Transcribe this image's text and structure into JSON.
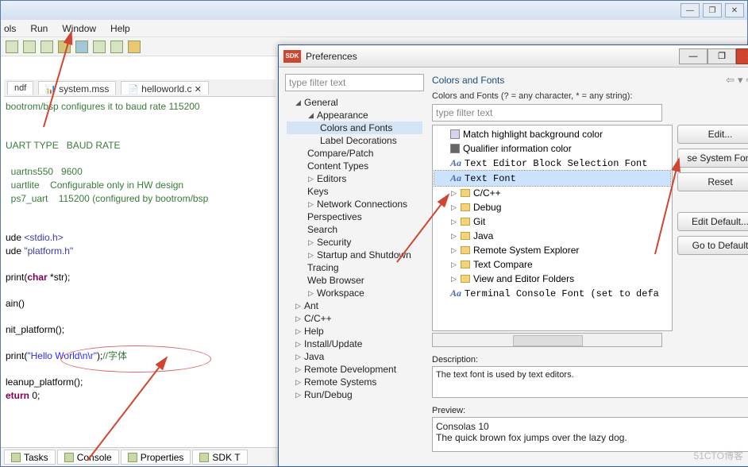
{
  "main": {
    "menu": [
      "ols",
      "Run",
      "Window",
      "Help"
    ],
    "tabs": {
      "mdf": "ndf",
      "mss": "system.mss",
      "hw": "helloworld.c"
    },
    "code": {
      "l1": "bootrom/bsp configures it to baud rate 115200",
      "hdr1": "UART TYPE   BAUD RATE",
      "u1": "  uartns550   9600",
      "u2": "  uartlite    Configurable only in HW design",
      "u3": "  ps7_uart    115200 (configured by bootrom/bsp",
      "inc1": "ude ",
      "inc1b": "<stdio.h>",
      "inc2": "ude ",
      "inc2b": "\"platform.h\"",
      "fn1": "print(",
      "fn1t": "char",
      " fn1r": " *str);",
      "fn2": "ain()",
      "ip": "nit_platform();",
      "pr": "print(",
      "prs": "\"Hello World\\n\\r\"",
      "prr": ");",
      "prc": "//字体",
      "cl": "leanup_platform();",
      "ret": "eturn",
      " retv": " 0;"
    },
    "btabs": [
      "Tasks",
      "Console",
      "Properties",
      "SDK T"
    ]
  },
  "pref": {
    "title": "Preferences",
    "logo": "SDK",
    "filter_ph": "type filter text",
    "tree": {
      "general": "General",
      "appearance": "Appearance",
      "colors_fonts": "Colors and Fonts",
      "label_dec": "Label Decorations",
      "compare": "Compare/Patch",
      "content": "Content Types",
      "editors": "Editors",
      "keys": "Keys",
      "network": "Network Connections",
      "persp": "Perspectives",
      "search": "Search",
      "security": "Security",
      "startup": "Startup and Shutdown",
      "tracing": "Tracing",
      "web": "Web Browser",
      "workspace": "Workspace",
      "ant": "Ant",
      "cpp": "C/C++",
      "help": "Help",
      "install": "Install/Update",
      "java": "Java",
      "remote": "Remote Development",
      "remotes": "Remote Systems",
      "rundebug": "Run/Debug"
    },
    "right": {
      "heading": "Colors and Fonts",
      "desc": "Colors and Fonts (? = any character, * = any string):",
      "filter_ph": "type filter text",
      "items": {
        "match": "Match highlight background color",
        "qual": "Qualifier information color",
        "block": "Text Editor Block Selection Font",
        "text": "Text Font",
        "cpp": "C/C++",
        "debug": "Debug",
        "git": "Git",
        "java": "Java",
        "rse": "Remote System Explorer",
        "tcmp": "Text Compare",
        "view": "View and Editor Folders",
        "term": "Terminal Console Font (set to defa"
      },
      "btns": {
        "edit": "Edit...",
        "sys": "se System Font",
        "reset": "Reset",
        "editd": "Edit Default...",
        "gotod": "Go to Default"
      },
      "desc_lbl": "Description:",
      "desc_txt": "The text font is used by text editors.",
      "prev_lbl": "Preview:",
      "prev_l1": "Consolas 10",
      "prev_l2": "The quick brown fox jumps over the lazy dog."
    }
  },
  "watermark": "51CTO博客"
}
